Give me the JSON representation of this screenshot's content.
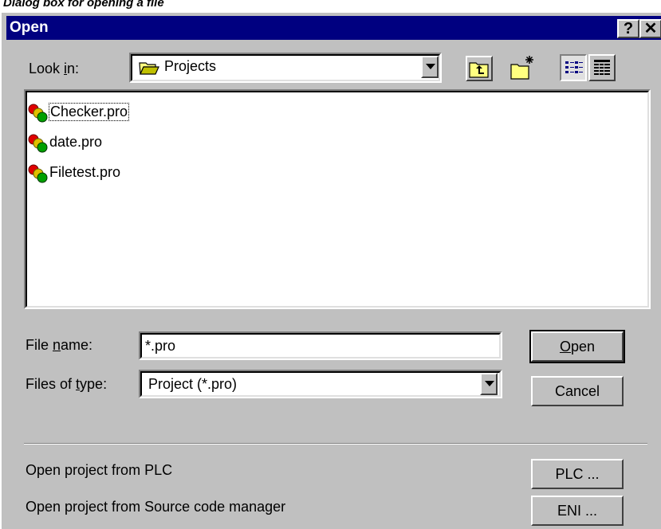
{
  "caption": "Dialog box for opening a file",
  "window": {
    "title": "Open",
    "help_label": "?",
    "close_label": "✕"
  },
  "look_in": {
    "label_pre": "Look ",
    "label_u": "i",
    "label_post": "n:",
    "value": "Projects"
  },
  "toolbar": {
    "icons": [
      "up-one-level-icon",
      "create-new-folder-icon",
      "list-view-icon",
      "details-view-icon"
    ]
  },
  "files": [
    {
      "name": "Checker.pro",
      "focused": true
    },
    {
      "name": "date.pro",
      "focused": false
    },
    {
      "name": "Filetest.pro",
      "focused": false
    }
  ],
  "file_name": {
    "label_pre": "File ",
    "label_u": "n",
    "label_post": "ame:",
    "value": "*.pro"
  },
  "file_type": {
    "label_pre": "Files of ",
    "label_u": "t",
    "label_post": "ype:",
    "value": "Project (*.pro)"
  },
  "buttons": {
    "open_u": "O",
    "open_rest": "pen",
    "cancel": "Cancel",
    "plc": "PLC ...",
    "eni": "ENI ..."
  },
  "extra": {
    "plc_text": "Open project from PLC",
    "eni_text": "Open project from Source code manager"
  },
  "colors": {
    "titlebar": "#000080",
    "face": "#c0c0c0"
  }
}
